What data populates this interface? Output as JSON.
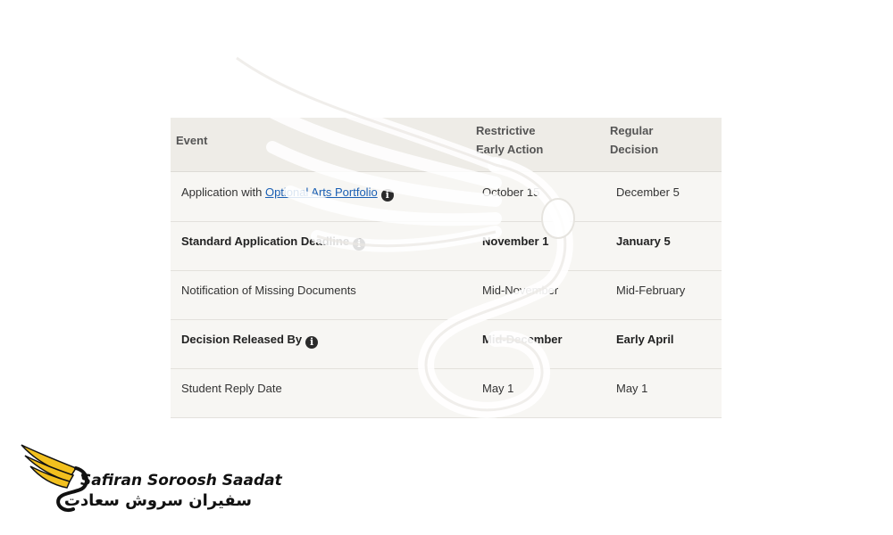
{
  "table": {
    "headers": {
      "event": "Event",
      "restrictive_early_action": [
        "Restrictive",
        "Early Action"
      ],
      "regular_decision": [
        "Regular",
        "Decision"
      ]
    },
    "rows": [
      {
        "event_prefix": "Application with ",
        "event_link": "Optional Arts Portfolio",
        "has_info_icon": true,
        "bold": false,
        "rea": "October 15",
        "rd": "December 5"
      },
      {
        "event": "Standard Application Deadline",
        "has_info_icon": true,
        "bold": true,
        "rea": "November 1",
        "rd": "January 5"
      },
      {
        "event": "Notification of Missing Documents",
        "has_info_icon": false,
        "bold": false,
        "rea": "Mid-November",
        "rd": "Mid-February"
      },
      {
        "event": "Decision Released By",
        "has_info_icon": true,
        "bold": true,
        "rea": "Mid-December",
        "rd": "Early April"
      },
      {
        "event": "Student Reply Date",
        "has_info_icon": false,
        "bold": false,
        "rea": "May 1",
        "rd": "May 1"
      }
    ],
    "info_icon": "info-icon"
  },
  "logo": {
    "name_en": "Safiran Soroosh Saadat",
    "name_fa": "سفیران سروش سعادت",
    "colors": {
      "wing": "#f2c01e",
      "outline": "#111111"
    }
  },
  "watermark": {
    "icon": "swan-wing-logo-watermark"
  },
  "colors": {
    "header_bg": "#eeece7",
    "row_bg": "#f7f6f3",
    "link": "#1a5fb4",
    "icon_bg": "#2b2b2b"
  }
}
